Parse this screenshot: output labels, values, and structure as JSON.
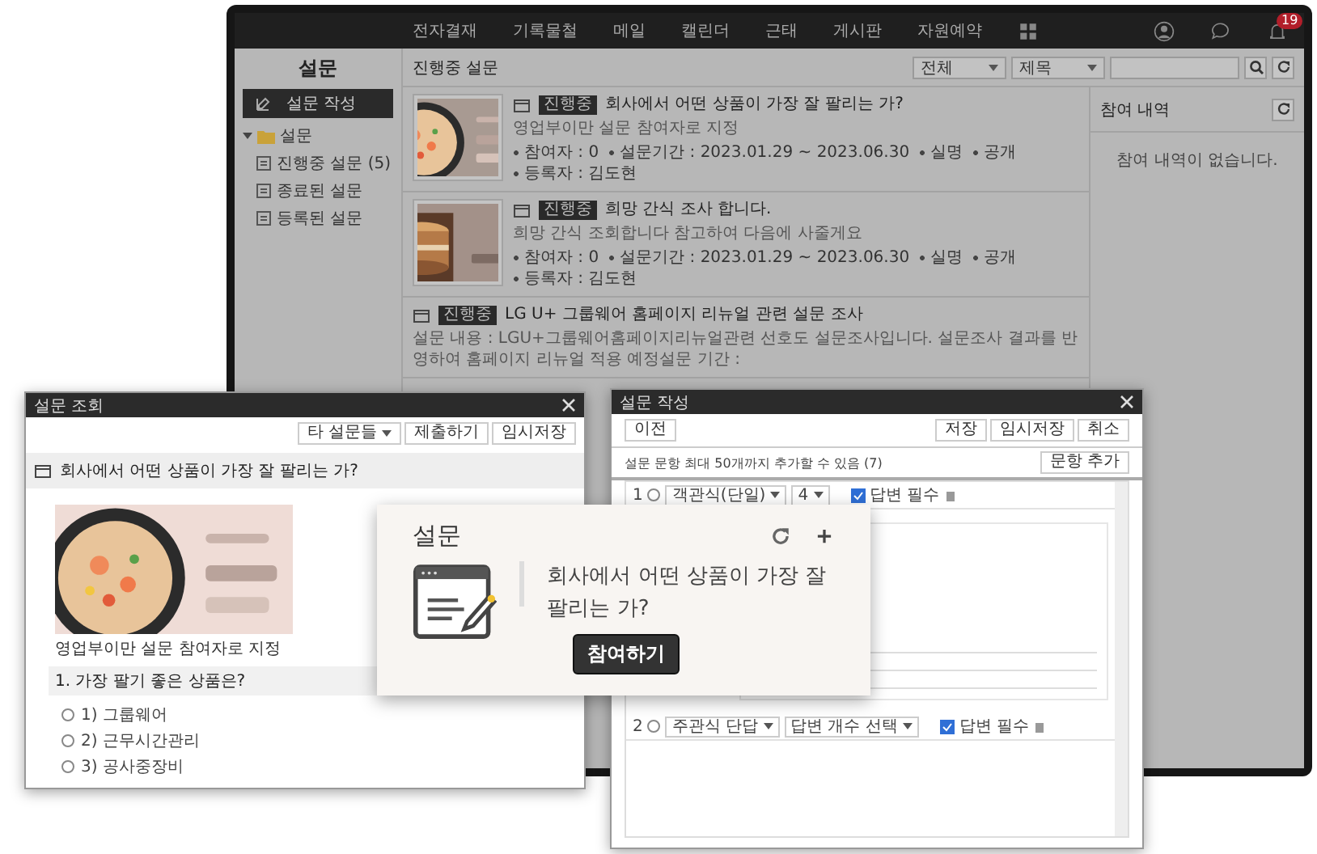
{
  "main_window": {
    "nav": [
      "전자결재",
      "기록물철",
      "메일",
      "캘린더",
      "근태",
      "게시판",
      "자원예약"
    ],
    "notification_count": "19",
    "sidebar": {
      "title": "설문",
      "create_button": "설문 작성",
      "tree": [
        {
          "label": "설문",
          "expanded": true,
          "children": [
            {
              "label": "진행중 설문 (5)"
            },
            {
              "label": "종료된 설문"
            },
            {
              "label": "등록된 설문"
            }
          ]
        }
      ]
    },
    "header": {
      "title": "진행중 설문",
      "filter": "전체",
      "field": "제목"
    },
    "surveys": [
      {
        "status": "진행중",
        "title": "회사에서 어떤 상품이 가장 잘 팔리는 가?",
        "description": "영업부이만 설문 참여자로 지정",
        "meta": [
          "참여자 : 0",
          "설문기간 : 2023.01.29 ~ 2023.06.30",
          "실명",
          "공개",
          "등록자 : 김도현"
        ]
      },
      {
        "status": "진행중",
        "title": "희망 간식 조사 합니다.",
        "description": "희망 간식 조회합니다 참고하여 다음에 사줄게요",
        "meta": [
          "참여자 : 0",
          "설문기간 : 2023.01.29 ~ 2023.06.30",
          "실명",
          "공개",
          "등록자 : 김도현"
        ]
      },
      {
        "status": "진행중",
        "title": "LG U+ 그룹웨어 홈페이지 리뉴얼 관련 설문 조사",
        "description": "설문 내용 : LGU+그룹웨어홈페이지리뉴얼관련 선호도 설문조사입니다. 설문조사 결과를 반영하여 홈페이지 리뉴얼 적용 예정설문 기간 :"
      }
    ],
    "participation": {
      "title": "참여 내역",
      "empty": "참여 내역이 없습니다."
    }
  },
  "view_dialog": {
    "title": "설문 조회",
    "buttons": [
      "타 설문들",
      "제출하기",
      "임시저장"
    ],
    "survey_title": "회사에서 어떤 상품이 가장 잘 팔리는 가?",
    "caption": "영업부이만 설문 참여자로 지정",
    "question": "1. 가장 팔기 좋은 상품은?",
    "options": [
      {
        "label": "1) 그룹웨어",
        "selected": false
      },
      {
        "label": "2) 근무시간관리",
        "selected": false
      },
      {
        "label": "3) 공사중장비",
        "selected": false
      }
    ]
  },
  "create_dialog": {
    "title": "설문 작성",
    "back_button": "이전",
    "buttons": [
      "저장",
      "임시저장",
      "취소"
    ],
    "hint": "설문 문항 최대 50개까지 추가할 수 있음 (7)",
    "add_button": "문항 추가",
    "questions": [
      {
        "selected": false,
        "number": "1",
        "type": "객관식(단일)",
        "count": "4",
        "required_label": "답변 필수",
        "required": true
      },
      {
        "selected": false,
        "number": "2",
        "type": "주관식 단답",
        "count": "답변 개수 선택",
        "required_label": "답변 필수",
        "required": true
      }
    ]
  },
  "widget": {
    "title": "설문",
    "question": "회사에서 어떤 상품이 가장 잘 팔리는 가?",
    "button": "참여하기"
  }
}
